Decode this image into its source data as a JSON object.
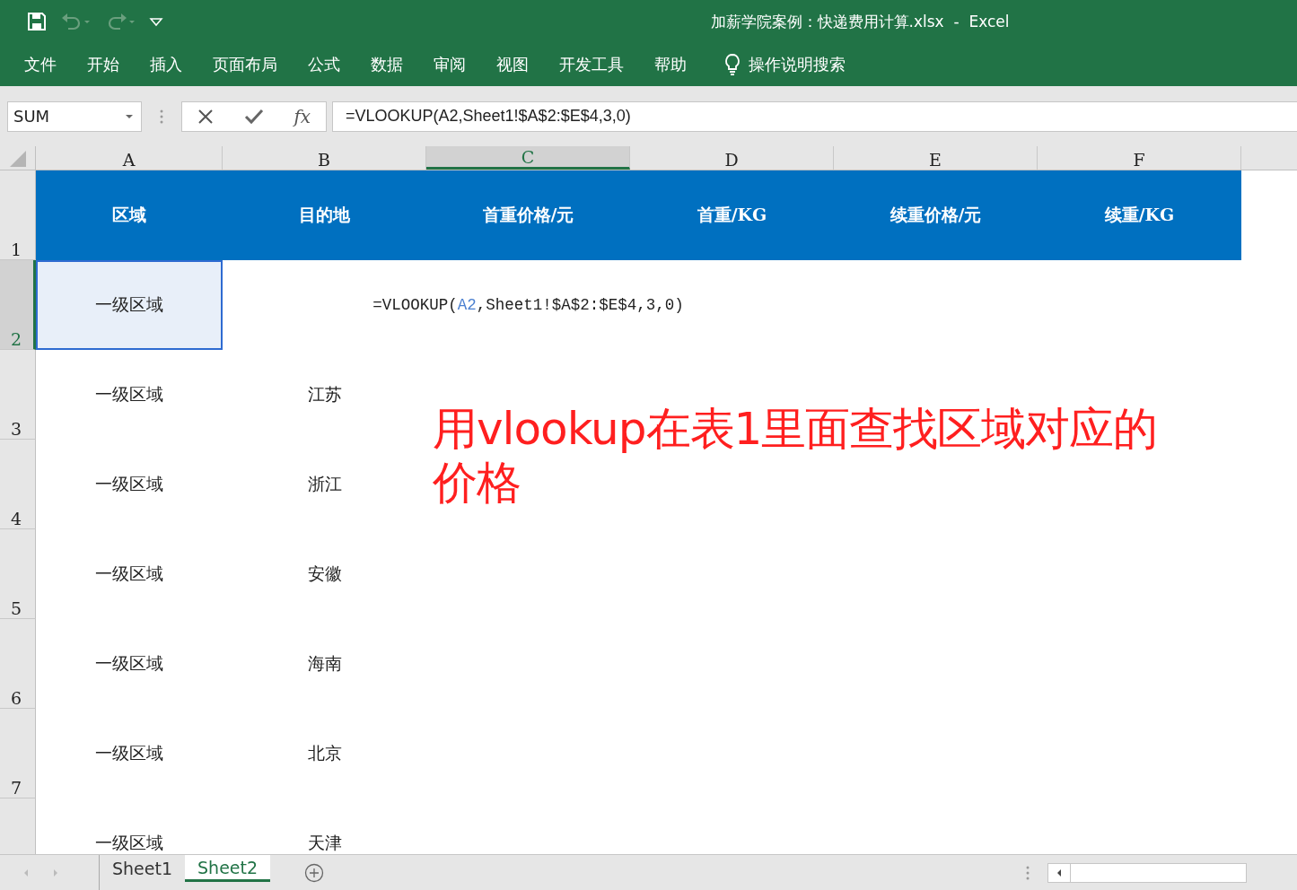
{
  "window": {
    "title": "加薪学院案例：快递费用计算.xlsx  -  Excel"
  },
  "ribbon_tabs": [
    {
      "label": "文件",
      "selected": false
    },
    {
      "label": "开始",
      "selected": false
    },
    {
      "label": "插入",
      "selected": false
    },
    {
      "label": "页面布局",
      "selected": false
    },
    {
      "label": "公式",
      "selected": false
    },
    {
      "label": "数据",
      "selected": false
    },
    {
      "label": "审阅",
      "selected": false
    },
    {
      "label": "视图",
      "selected": false
    },
    {
      "label": "开发工具",
      "selected": false
    },
    {
      "label": "帮助",
      "selected": false
    }
  ],
  "tell_me": {
    "label": "操作说明搜索"
  },
  "formula_bar": {
    "name_box": "SUM",
    "fx": "fx",
    "formula": "=VLOOKUP(A2,Sheet1!$A$2:$E$4,3,0)"
  },
  "columns": [
    {
      "label": "A",
      "selected": false
    },
    {
      "label": "B",
      "selected": false
    },
    {
      "label": "C",
      "selected": true
    },
    {
      "label": "D",
      "selected": false
    },
    {
      "label": "E",
      "selected": false
    },
    {
      "label": "F",
      "selected": false
    }
  ],
  "rows": [
    {
      "number": "1",
      "selected": false,
      "kind": "header",
      "cells": [
        "区域",
        "目的地",
        "首重价格/元",
        "首重/KG",
        "续重价格/元",
        "续重/KG"
      ]
    },
    {
      "number": "2",
      "selected": true,
      "kind": "data",
      "cells": [
        {
          "text": "一级区域",
          "highlighted": true
        },
        null,
        {
          "kind": "formula",
          "parts": [
            {
              "text": "=VLOOKUP(",
              "kind": "plain"
            },
            {
              "text": "A2",
              "kind": "ref"
            },
            {
              "text": ",Sheet1!$A$2:$E$4,3,0)",
              "kind": "plain"
            }
          ]
        },
        null,
        null,
        null
      ]
    },
    {
      "number": "3",
      "selected": false,
      "kind": "data",
      "cells": [
        {
          "text": "一级区域",
          "highlighted": false
        },
        {
          "text": "江苏",
          "highlighted": false
        },
        null,
        null,
        null,
        null
      ]
    },
    {
      "number": "4",
      "selected": false,
      "kind": "data",
      "cells": [
        {
          "text": "一级区域",
          "highlighted": false
        },
        {
          "text": "浙江",
          "highlighted": false
        },
        null,
        null,
        null,
        null
      ]
    },
    {
      "number": "5",
      "selected": false,
      "kind": "data",
      "cells": [
        {
          "text": "一级区域",
          "highlighted": false
        },
        {
          "text": "安徽",
          "highlighted": false
        },
        null,
        null,
        null,
        null
      ]
    },
    {
      "number": "6",
      "selected": false,
      "kind": "data",
      "cells": [
        {
          "text": "一级区域",
          "highlighted": false
        },
        {
          "text": "海南",
          "highlighted": false
        },
        null,
        null,
        null,
        null
      ]
    },
    {
      "number": "7",
      "selected": false,
      "kind": "data",
      "cells": [
        {
          "text": "一级区域",
          "highlighted": false
        },
        {
          "text": "北京",
          "highlighted": false
        },
        null,
        null,
        null,
        null
      ]
    },
    {
      "selected": false,
      "kind": "data",
      "cells": [
        {
          "text": "一级区域",
          "highlighted": false
        },
        {
          "text": "天津",
          "highlighted": false
        },
        null,
        null,
        null,
        null
      ]
    }
  ],
  "annotation": "用vlookup在表1里面查找区域对应的价格",
  "sheet_tabs": [
    {
      "label": "Sheet1",
      "selected": false
    },
    {
      "label": "Sheet2",
      "selected": true
    }
  ]
}
